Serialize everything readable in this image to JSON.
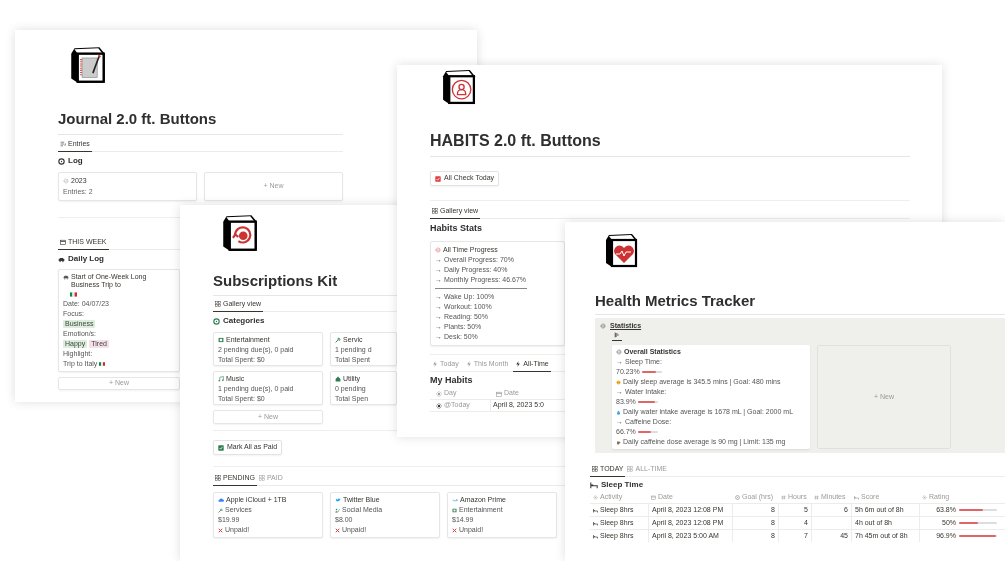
{
  "journal": {
    "title": "Journal 2.0 ft. Buttons",
    "tabs": [
      {
        "label": "Entries",
        "selected": true
      }
    ],
    "log": {
      "heading": "Log",
      "cards": [
        {
          "title": "2023",
          "detail": "Entries: 2"
        }
      ],
      "new_label": "+ New"
    },
    "week_tabs": [
      {
        "label": "THIS WEEK",
        "selected": true
      }
    ],
    "daily_log": {
      "heading": "Daily Log",
      "entry": {
        "title": "Start of One-Week Long Business Trip to",
        "date": "Date: 04/07/23",
        "focus_label": "Focus:",
        "focus_tags": [
          {
            "label": "Business",
            "color": "#dbeddb"
          }
        ],
        "emotion_label": "Emotion/s:",
        "emotion_tags": [
          {
            "label": "Happy",
            "color": "#dbeddb"
          },
          {
            "label": "Tired",
            "color": "#f5e0e9"
          }
        ],
        "highlight_label": "Highlight:",
        "highlight": "Trip to Italy"
      },
      "new_label": "+ New"
    }
  },
  "subscriptions": {
    "title": "Subscriptions Kit",
    "tabs": [
      {
        "label": "Gallery view",
        "selected": true
      }
    ],
    "categories": {
      "heading": "Categories",
      "cards": [
        {
          "name": "Entertainment",
          "dues": "2 pending due(s), 0 paid",
          "spent": "Total Spent: $0"
        },
        {
          "name": "Servic",
          "dues": "1 pending d",
          "spent": "Total Spent"
        },
        {
          "name": "Music",
          "dues": "1 pending due(s), 0 paid",
          "spent": "Total Spent: $0"
        },
        {
          "name": "Utility",
          "dues": "0 pending",
          "spent": "Total Spen"
        }
      ],
      "new_label": "+ New"
    },
    "button": "Mark All as Paid",
    "status_tabs": [
      {
        "label": "PENDING",
        "selected": true
      },
      {
        "label": "PAID",
        "selected": false
      }
    ],
    "items": [
      {
        "name": "Apple iCloud + 1TB",
        "category": "Services",
        "price": "$19.99",
        "status": "Unpaid!"
      },
      {
        "name": "Twitter Blue",
        "category": "Social Media",
        "price": "$8.00",
        "status": "Unpaid!"
      },
      {
        "name": "Amazon Prime",
        "category": "Entertainment",
        "price": "$14.99",
        "status": "Unpaid!"
      }
    ]
  },
  "habits": {
    "title": "HABITS 2.0 ft. Buttons",
    "button": "All Check Today",
    "tabs": [
      {
        "label": "Gallery view",
        "selected": true
      }
    ],
    "stats": {
      "heading": "Habits Stats",
      "card_title": "All Time Progress",
      "summary": [
        "→ Overall Progress: 70%",
        "→ Daily Progress: 40%",
        "→ Monthly Progress: 46.67%"
      ],
      "habits": [
        "→ Wake Up: 100%",
        "→ Workout: 100%",
        "→ Reading: 50%",
        "→ Plants: 50%",
        "→ Desk: 50%"
      ]
    },
    "view_tabs": [
      {
        "label": "Today",
        "selected": false
      },
      {
        "label": "This Month",
        "selected": false
      },
      {
        "label": "All-Time",
        "selected": true
      }
    ],
    "table": {
      "heading": "My Habits",
      "columns": [
        "Day",
        "Date"
      ],
      "rows": [
        [
          "@Today",
          "April 8, 2023 5:0"
        ]
      ]
    }
  },
  "health": {
    "title": "Health Metrics Tracker",
    "statistics": {
      "link": "Statistics",
      "card_title": "Overall Statistics",
      "metrics": [
        {
          "label": "→ Sleep Time:",
          "percent": "70.23%",
          "level": 0.7023,
          "note": "Daily sleep average is 345.5 mins | Goal: 480 mins"
        },
        {
          "label": "→ Water Intake:",
          "percent": "83.9%",
          "level": 0.839,
          "note": "Daily water intake average is 1678 mL | Goal: 2000 mL"
        },
        {
          "label": "→ Caffeine Dose:",
          "percent": "66.7%",
          "level": 0.667,
          "note": "Daily caffeine dose average is 90 mg | Limit: 135 mg"
        }
      ],
      "new_label": "+ New"
    },
    "tabs": [
      {
        "label": "TODAY",
        "selected": true
      },
      {
        "label": "ALL-TIME",
        "selected": false
      }
    ],
    "table": {
      "heading": "Sleep Time",
      "columns": [
        "Activity",
        "Date",
        "Goal (hrs)",
        "Hours",
        "Minutes",
        "Score",
        "Rating"
      ],
      "rows": [
        {
          "activity": "Sleep 8hrs",
          "date": "April 8, 2023 12:08 PM",
          "goal": "8",
          "hours": "5",
          "minutes": "6",
          "score": "5h 6m out of 8h",
          "rating": "63.8%",
          "level": 0.638
        },
        {
          "activity": "Sleep 8hrs",
          "date": "April 8, 2023 12:08 PM",
          "goal": "8",
          "hours": "4",
          "score": "4h out of 8h",
          "rating": "50%",
          "level": 0.5
        },
        {
          "activity": "Sleep 8hrs",
          "date": "April 8, 2023 5:00 AM",
          "goal": "8",
          "hours": "7",
          "minutes": "45",
          "score": "7h 45m out of 8h",
          "rating": "96.9%",
          "level": 0.969
        }
      ]
    }
  }
}
